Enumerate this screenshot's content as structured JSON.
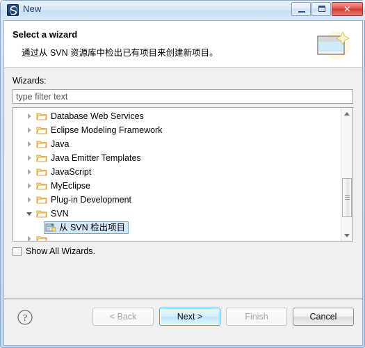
{
  "window": {
    "title": "New",
    "icon": "eclipse-app-icon",
    "controls": {
      "minimize": "minimize-button",
      "maximize": "maximize-button",
      "close_label": "✕"
    }
  },
  "header": {
    "title": "Select a wizard",
    "description": "通过从 SVN 资源库中检出已有项目来创建新项目。",
    "banner_icon": "wizard-banner-icon"
  },
  "main": {
    "wizards_label": "Wizards:",
    "filter": {
      "value": "",
      "placeholder": "type filter text"
    },
    "tree": [
      {
        "label": "Database Web Services",
        "expanded": false,
        "type": "folder",
        "indent": 0
      },
      {
        "label": "Eclipse Modeling Framework",
        "expanded": false,
        "type": "folder",
        "indent": 0
      },
      {
        "label": "Java",
        "expanded": false,
        "type": "folder",
        "indent": 0
      },
      {
        "label": "Java Emitter Templates",
        "expanded": false,
        "type": "folder",
        "indent": 0
      },
      {
        "label": "JavaScript",
        "expanded": false,
        "type": "folder",
        "indent": 0
      },
      {
        "label": "MyEclipse",
        "expanded": false,
        "type": "folder",
        "indent": 0
      },
      {
        "label": "Plug-in Development",
        "expanded": false,
        "type": "folder",
        "indent": 0
      },
      {
        "label": "SVN",
        "expanded": true,
        "type": "folder",
        "indent": 0
      },
      {
        "label": "从 SVN 检出项目",
        "expanded": false,
        "type": "leaf",
        "indent": 1,
        "selected": true
      }
    ],
    "show_all_wizards": {
      "label": "Show All Wizards.",
      "checked": false
    },
    "scrollbar": {
      "up_arrow": "scroll-up-arrow",
      "down_arrow": "scroll-down-arrow"
    }
  },
  "footer": {
    "help_icon": "help-icon",
    "buttons": [
      {
        "label": "< Back",
        "enabled": false,
        "primary": false
      },
      {
        "label": "Next >",
        "enabled": true,
        "primary": true
      },
      {
        "label": "Finish",
        "enabled": false,
        "primary": false
      },
      {
        "label": "Cancel",
        "enabled": true,
        "primary": false
      }
    ]
  },
  "colors": {
    "accent": "#3fa4d8",
    "selection_bg": "#d4e7f7",
    "selection_border": "#7aa8d4",
    "title_text": "#1d3c60",
    "close_button": "#cf3a2c",
    "folder": "#f0c060"
  }
}
